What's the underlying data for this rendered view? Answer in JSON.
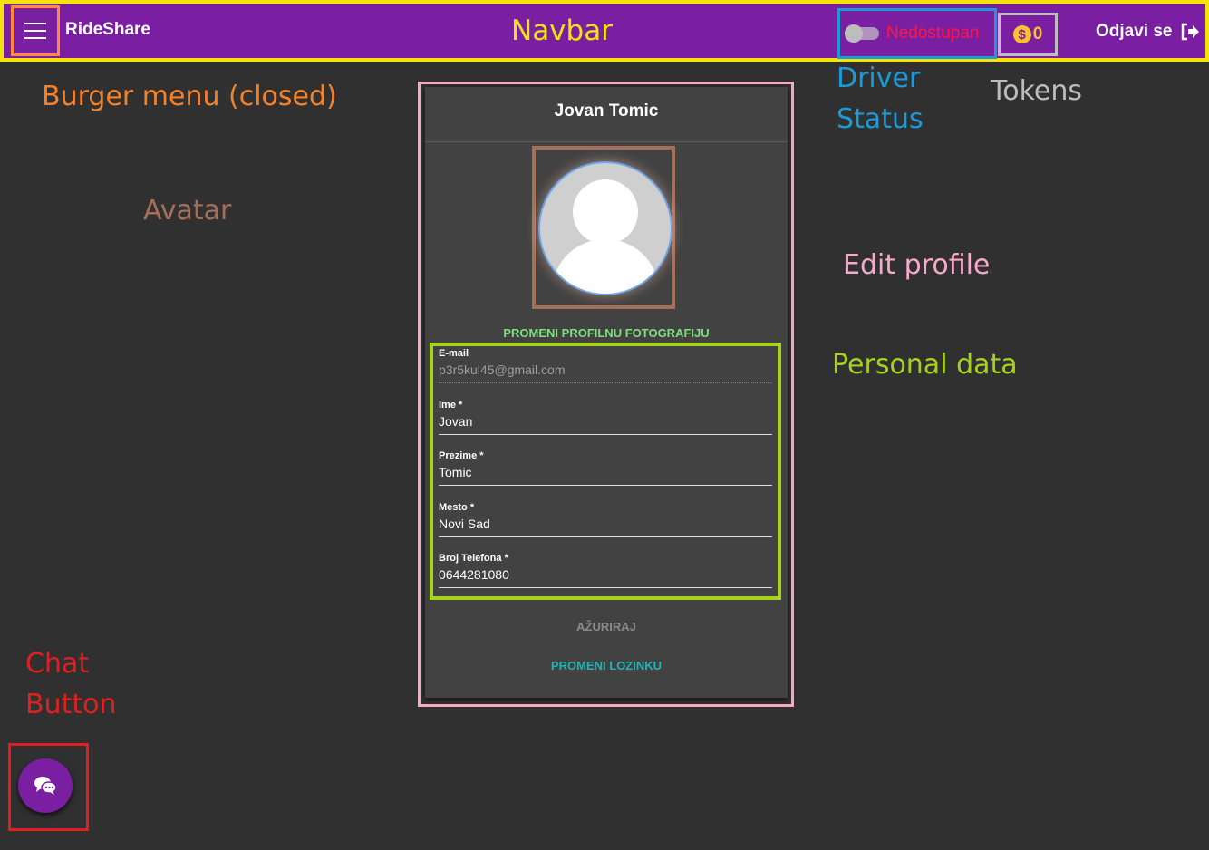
{
  "navbar": {
    "brand": "RideShare",
    "annotation": "Navbar",
    "driver_status_label": "Nedostupan",
    "tokens": "0",
    "logout_label": "Odjavi se"
  },
  "annotations": {
    "burger_menu": "Burger menu (closed)",
    "driver_status_line1": "Driver",
    "driver_status_line2": "Status",
    "tokens": "Tokens",
    "avatar": "Avatar",
    "edit_profile": "Edit profile",
    "personal_data": "Personal data",
    "chat_line1": "Chat",
    "chat_line2": "Button"
  },
  "profile": {
    "full_name": "Jovan Tomic",
    "change_photo_label": "PROMENI PROFILNU FOTOGRAFIJU",
    "fields": [
      {
        "label": "E-mail",
        "value": "p3r5kul45@gmail.com"
      },
      {
        "label": "Ime *",
        "value": "Jovan"
      },
      {
        "label": "Prezime *",
        "value": "Tomic"
      },
      {
        "label": "Mesto *",
        "value": "Novi Sad"
      },
      {
        "label": "Broj Telefona *",
        "value": "0644281080"
      }
    ],
    "update_label": "AŽURIRAJ",
    "change_password_label": "PROMENI LOZINKU"
  },
  "colors": {
    "navbar": "#7b1fa2",
    "background": "#303030",
    "card": "#424242",
    "status_unavailable": "#ff1744",
    "tokens": "#fbc02d",
    "change_photo": "#7ee07e",
    "change_password": "#21b3b3"
  },
  "icons": {
    "menu": "hamburger-icon",
    "coin": "dollar-coin-icon",
    "logout": "logout-arrow-icon",
    "chat": "chat-bubbles-icon"
  }
}
